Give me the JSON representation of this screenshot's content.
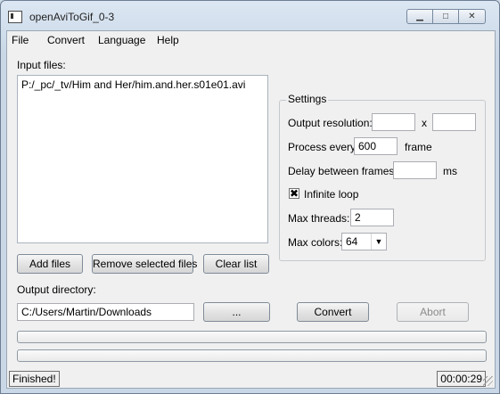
{
  "window": {
    "title": "openAviToGif_0-3"
  },
  "menu": [
    "File",
    "Convert",
    "Language",
    "Help"
  ],
  "input": {
    "label": "Input files:",
    "files": [
      "P:/_pc/_tv/Him and Her/him.and.her.s01e01.avi"
    ]
  },
  "file_buttons": {
    "add": "Add files",
    "remove": "Remove selected files",
    "clear": "Clear list"
  },
  "settings": {
    "title": "Settings",
    "output_resolution_label": "Output resolution:",
    "resolution_width": "",
    "resolution_x": "x",
    "resolution_height": "",
    "process_every_label": "Process every",
    "process_every_value": "600",
    "process_every_unit": "frame",
    "delay_label": "Delay between frames:",
    "delay_value": "",
    "delay_unit": "ms",
    "infinite_loop_label": "Infinite loop",
    "infinite_loop_checked": true,
    "infinite_loop_mark": "✖",
    "max_threads_label": "Max threads:",
    "max_threads_value": "2",
    "max_colors_label": "Max colors:",
    "max_colors_value": "64"
  },
  "output": {
    "label": "Output directory:",
    "path": "C:/Users/Martin/Downloads",
    "browse": "...",
    "convert": "Convert",
    "abort": "Abort"
  },
  "progress": {
    "file_progress": 0,
    "total_progress": 0
  },
  "status": {
    "message": "Finished!",
    "elapsed": "00:00:29"
  },
  "icons": {
    "minimize": "minimize-icon",
    "maximize": "maximize-icon",
    "close": "close-icon",
    "dropdown": "chevron-down-icon"
  }
}
